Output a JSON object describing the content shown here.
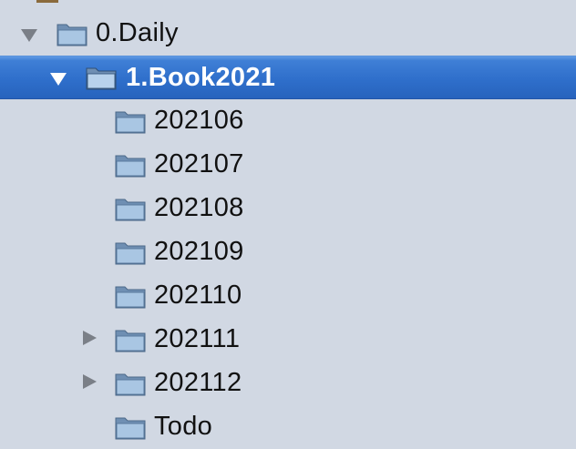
{
  "tree": {
    "items": [
      {
        "label": "0.Daily",
        "state": "expanded",
        "selected": false
      },
      {
        "label": "1.Book2021",
        "state": "expanded",
        "selected": true
      },
      {
        "label": "202106",
        "state": "leaf",
        "selected": false
      },
      {
        "label": "202107",
        "state": "leaf",
        "selected": false
      },
      {
        "label": "202108",
        "state": "leaf",
        "selected": false
      },
      {
        "label": "202109",
        "state": "leaf",
        "selected": false
      },
      {
        "label": "202110",
        "state": "leaf",
        "selected": false
      },
      {
        "label": "202111",
        "state": "collapsed",
        "selected": false
      },
      {
        "label": "202112",
        "state": "collapsed",
        "selected": false
      },
      {
        "label": "Todo",
        "state": "leaf",
        "selected": false
      }
    ]
  },
  "colors": {
    "background": "#d1d8e3",
    "selection": "#2f6fcb",
    "folder": "#9cbcdc",
    "disclosure": "#7a7f87"
  }
}
